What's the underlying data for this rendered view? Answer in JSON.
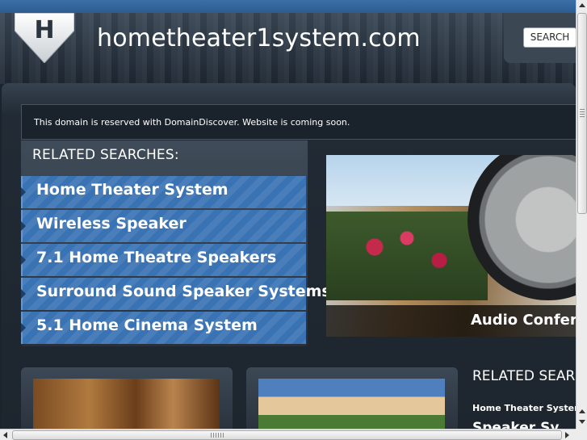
{
  "header": {
    "logo_letter": "H",
    "site_title": "hometheater1system.com",
    "search_label": "SEARCH"
  },
  "notice": "This domain is reserved with DomainDiscover. Website is coming soon.",
  "related_left": {
    "heading": "RELATED SEARCHES:",
    "items": [
      {
        "label": "Home Theater System"
      },
      {
        "label": "Wireless Speaker"
      },
      {
        "label": "7.1 Home Theatre Speakers"
      },
      {
        "label": "Surround Sound Speaker Systems"
      },
      {
        "label": "5.1 Home Cinema System"
      }
    ]
  },
  "hero": {
    "caption": "Audio Confere"
  },
  "related_right": {
    "heading": "RELATED SEAR",
    "items": [
      {
        "label": "Home Theater System"
      },
      {
        "label": "Speaker Sy"
      }
    ]
  },
  "colors": {
    "link_bg": "#3a73b4",
    "page_bg": "#1b232d",
    "topstrip": "#2d5d92"
  }
}
